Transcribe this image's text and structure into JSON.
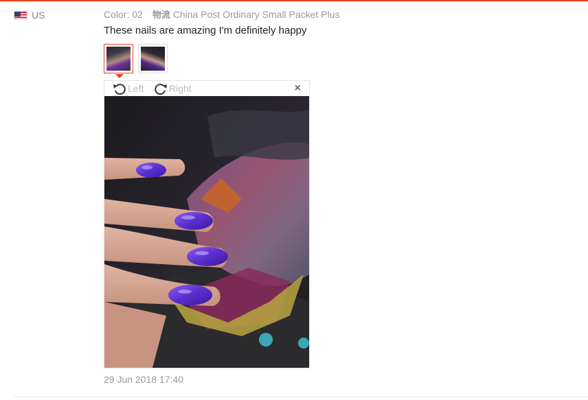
{
  "country": {
    "code": "US"
  },
  "review": {
    "color_label": "Color: 02",
    "shipping_label": "物流",
    "shipping_method": "China Post Ordinary Small Packet Plus",
    "text": "These nails are amazing I'm definitely happy",
    "date": "29 Jun 2018 17:40"
  },
  "viewer": {
    "rotate_left_label": "Left",
    "rotate_right_label": "Right",
    "close_label": "×"
  },
  "colors": {
    "accent": "#e0451f",
    "nail_purple": "#6b2fd0"
  },
  "icons": [
    "us-flag-icon",
    "rotate-left-icon",
    "rotate-right-icon",
    "close-icon"
  ]
}
